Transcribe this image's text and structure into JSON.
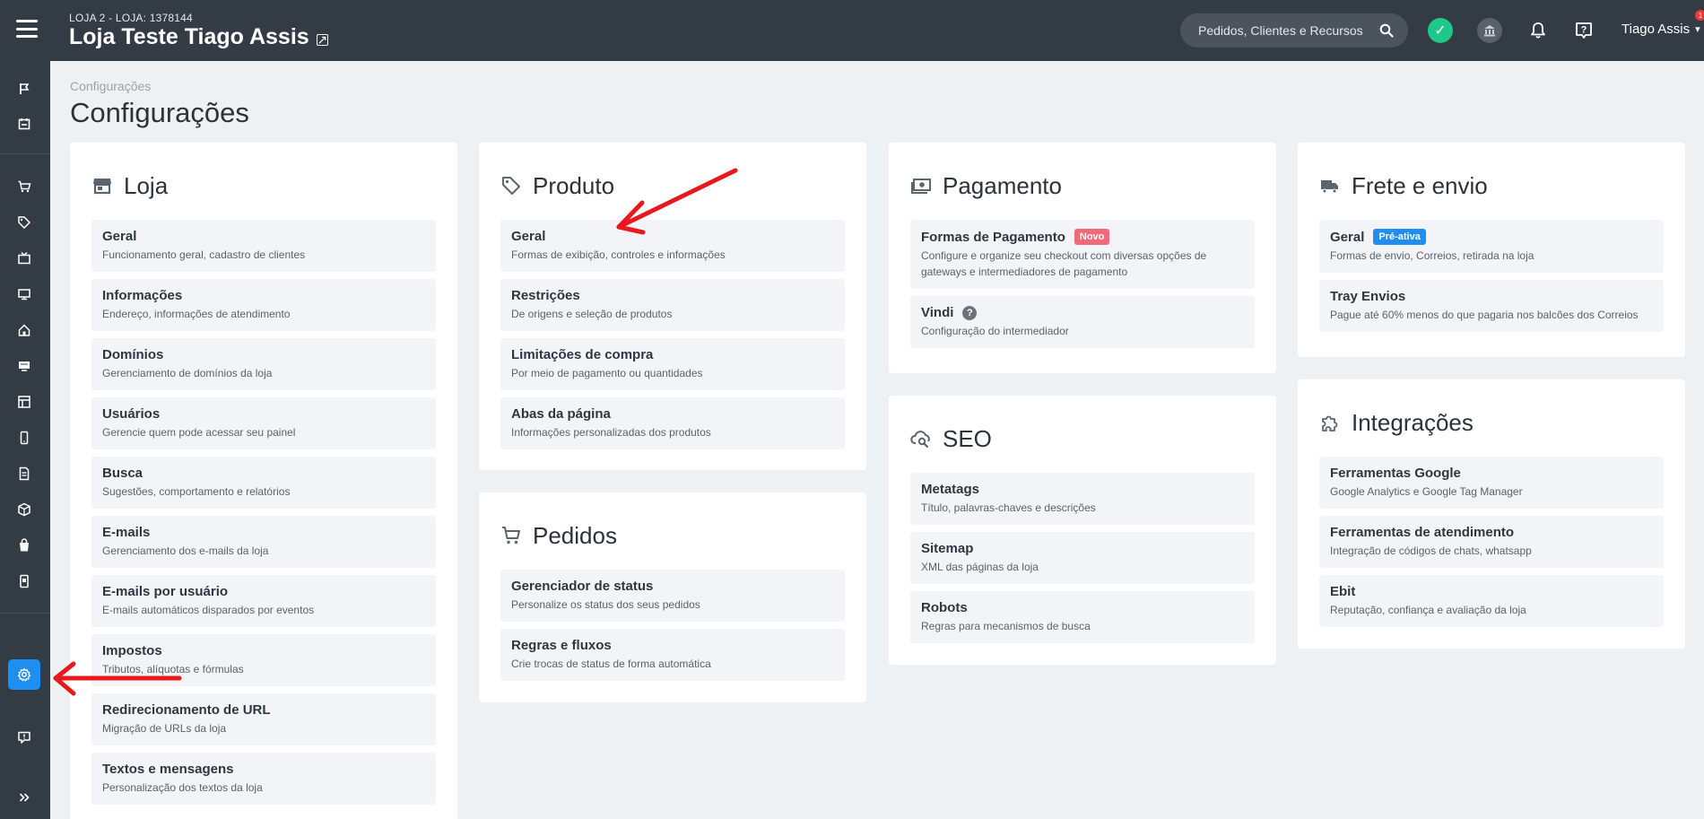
{
  "header": {
    "store_sub": "LOJA 2 - LOJA: 1378144",
    "store_name": "Loja Teste Tiago Assis",
    "search_placeholder": "Pedidos, Clientes e Recursos",
    "user_name": "Tiago Assis",
    "user_badge": "1"
  },
  "breadcrumb": "Configurações",
  "page_title": "Configurações",
  "cards": {
    "loja": {
      "title": "Loja",
      "items": [
        {
          "title": "Geral",
          "desc": "Funcionamento geral, cadastro de clientes"
        },
        {
          "title": "Informações",
          "desc": "Endereço, informações de atendimento"
        },
        {
          "title": "Domínios",
          "desc": "Gerenciamento de domínios da loja"
        },
        {
          "title": "Usuários",
          "desc": "Gerencie quem pode acessar seu painel"
        },
        {
          "title": "Busca",
          "desc": "Sugestões, comportamento e relatórios"
        },
        {
          "title": "E-mails",
          "desc": "Gerenciamento dos e-mails da loja"
        },
        {
          "title": "E-mails por usuário",
          "desc": "E-mails automáticos disparados por eventos"
        },
        {
          "title": "Impostos",
          "desc": "Tributos, alíquotas e fórmulas"
        },
        {
          "title": "Redirecionamento de URL",
          "desc": "Migração de URLs da loja"
        },
        {
          "title": "Textos e mensagens",
          "desc": "Personalização dos textos da loja"
        }
      ]
    },
    "produto": {
      "title": "Produto",
      "items": [
        {
          "title": "Geral",
          "desc": "Formas de exibição, controles e informações"
        },
        {
          "title": "Restrições",
          "desc": "De origens e seleção de produtos"
        },
        {
          "title": "Limitações de compra",
          "desc": "Por meio de pagamento ou quantidades"
        },
        {
          "title": "Abas da página",
          "desc": "Informações personalizadas dos produtos"
        }
      ]
    },
    "pedidos": {
      "title": "Pedidos",
      "items": [
        {
          "title": "Gerenciador de status",
          "desc": "Personalize os status dos seus pedidos"
        },
        {
          "title": "Regras e fluxos",
          "desc": "Crie trocas de status de forma automática"
        }
      ]
    },
    "pagamento": {
      "title": "Pagamento",
      "items": [
        {
          "title": "Formas de Pagamento",
          "badge": "Novo",
          "desc": "Configure e organize seu checkout com diversas opções de gateways e intermediadores de pagamento"
        },
        {
          "title": "Vindi",
          "badge": "?",
          "desc": "Configuração do intermediador"
        }
      ]
    },
    "seo": {
      "title": "SEO",
      "items": [
        {
          "title": "Metatags",
          "desc": "Título, palavras-chaves e descrições"
        },
        {
          "title": "Sitemap",
          "desc": "XML das páginas da loja"
        },
        {
          "title": "Robots",
          "desc": "Regras para mecanismos de busca"
        }
      ]
    },
    "frete": {
      "title": "Frete e envio",
      "items": [
        {
          "title": "Geral",
          "badge": "Pré-ativa",
          "desc": "Formas de envio, Correios, retirada na loja"
        },
        {
          "title": "Tray Envios",
          "desc": "Pague até 60% menos do que pagaria nos balcões dos Correios"
        }
      ]
    },
    "integracoes": {
      "title": "Integrações",
      "items": [
        {
          "title": "Ferramentas Google",
          "desc": "Google Analytics e Google Tag Manager"
        },
        {
          "title": "Ferramentas de atendimento",
          "desc": "Integração de códigos de chats, whatsapp"
        },
        {
          "title": "Ebit",
          "desc": "Reputação, confiança e avaliação da loja"
        }
      ]
    }
  },
  "colors": {
    "topbar": "#333b44",
    "accent": "#1f8ef1",
    "badge_new": "#f26a79",
    "annotation_arrow": "#e8191e"
  }
}
